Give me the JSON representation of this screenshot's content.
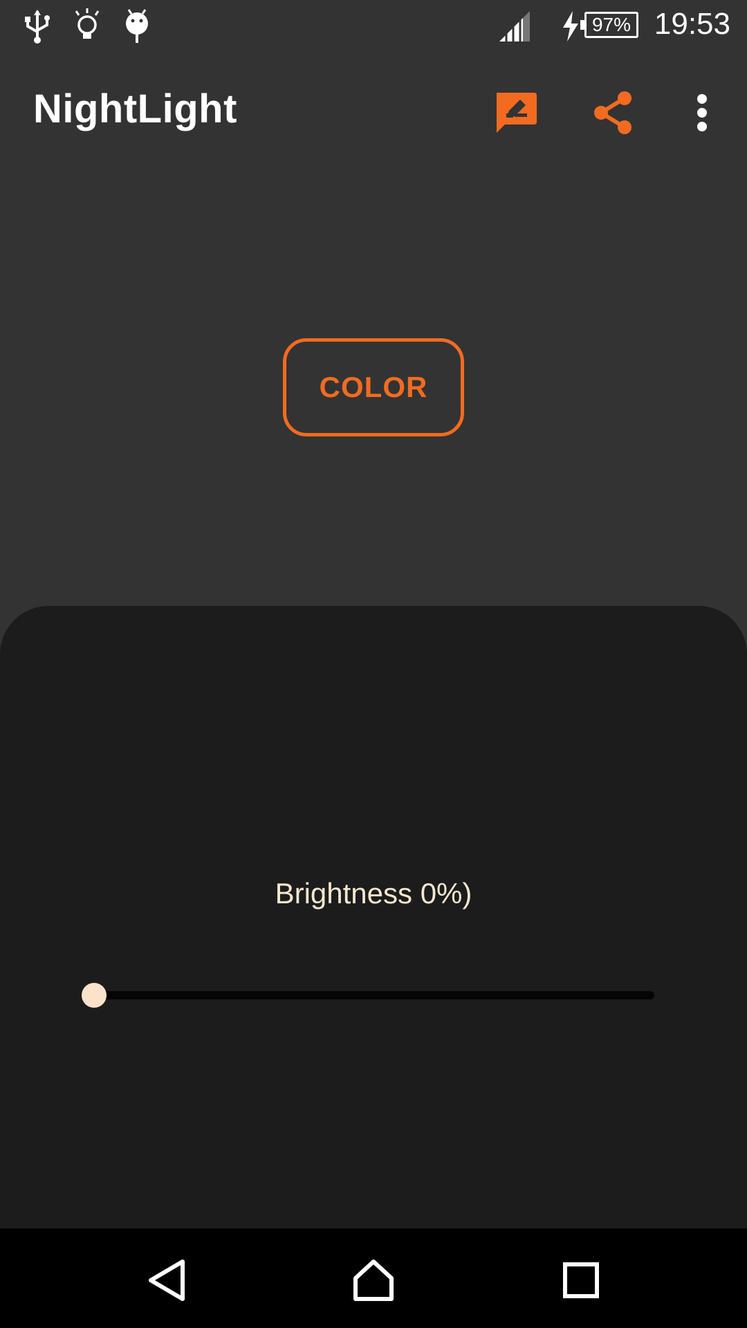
{
  "status_bar": {
    "time": "19:53",
    "battery": "97%",
    "icons": [
      "usb-icon",
      "lightbulb-icon",
      "android-icon",
      "signal-icon",
      "charging-icon",
      "battery-icon"
    ]
  },
  "toolbar": {
    "title": "NightLight",
    "actions": [
      "feedback-icon",
      "share-icon",
      "overflow-menu-icon"
    ]
  },
  "main": {
    "color_button_label": "COLOR"
  },
  "brightness": {
    "label": "Brightness 0%)",
    "value_fraction": 0.0
  },
  "nav_bar": {
    "buttons": [
      "back-icon",
      "home-icon",
      "recents-icon"
    ]
  },
  "colors": {
    "accent": "#F26B21",
    "background": "#333333",
    "panel": "#1C1C1C",
    "label_text": "#F8E6CF"
  }
}
